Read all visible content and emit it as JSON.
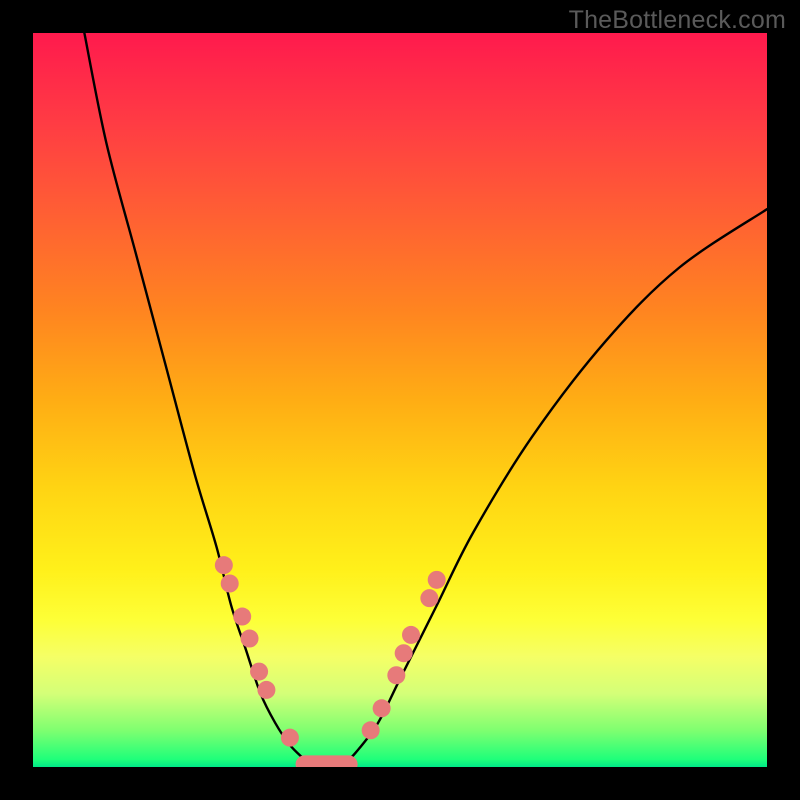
{
  "watermark": "TheBottleneck.com",
  "chart_data": {
    "type": "line",
    "title": "",
    "xlabel": "",
    "ylabel": "",
    "xlim": [
      0,
      100
    ],
    "ylim": [
      0,
      100
    ],
    "series": [
      {
        "name": "left-curve",
        "x": [
          7,
          10,
          14,
          18,
          22,
          25,
          27,
          29,
          31,
          33,
          35,
          37,
          38
        ],
        "y": [
          100,
          85,
          70,
          55,
          40,
          30,
          22,
          16,
          10,
          6,
          3,
          1,
          0
        ]
      },
      {
        "name": "right-curve",
        "x": [
          42,
          44,
          47,
          50,
          55,
          60,
          68,
          78,
          88,
          100
        ],
        "y": [
          0,
          2,
          6,
          12,
          22,
          32,
          45,
          58,
          68,
          76
        ]
      }
    ],
    "markers": {
      "color": "#e77a7a",
      "radius_px": 9,
      "left_branch": [
        {
          "x": 26.0,
          "y": 27.5
        },
        {
          "x": 26.8,
          "y": 25.0
        },
        {
          "x": 28.5,
          "y": 20.5
        },
        {
          "x": 29.5,
          "y": 17.5
        },
        {
          "x": 30.8,
          "y": 13.0
        },
        {
          "x": 31.8,
          "y": 10.5
        },
        {
          "x": 35.0,
          "y": 4.0
        }
      ],
      "right_branch": [
        {
          "x": 46.0,
          "y": 5.0
        },
        {
          "x": 47.5,
          "y": 8.0
        },
        {
          "x": 49.5,
          "y": 12.5
        },
        {
          "x": 50.5,
          "y": 15.5
        },
        {
          "x": 51.5,
          "y": 18.0
        },
        {
          "x": 54.0,
          "y": 23.0
        },
        {
          "x": 55.0,
          "y": 25.5
        }
      ],
      "bottom_band": [
        {
          "x": 37.0,
          "y": 0.5
        },
        {
          "x": 38.5,
          "y": 0.3
        },
        {
          "x": 40.0,
          "y": 0.2
        },
        {
          "x": 41.5,
          "y": 0.3
        },
        {
          "x": 43.0,
          "y": 0.5
        }
      ]
    }
  }
}
